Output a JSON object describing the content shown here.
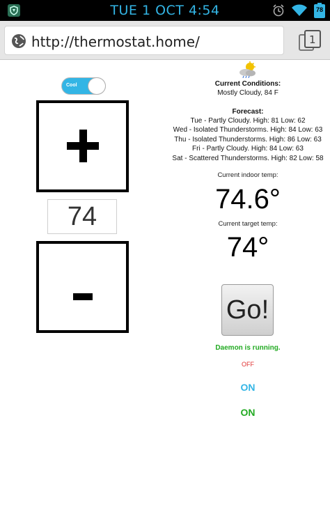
{
  "status_bar": {
    "time": "TUE 1 OCT 4:54",
    "battery_level": "78",
    "icons": [
      "shield-app-icon",
      "alarm-clock-icon",
      "wifi-icon",
      "battery-icon"
    ]
  },
  "browser": {
    "url": "http://thermostat.home/",
    "tabs_count": "1"
  },
  "controls": {
    "mode_toggle_label": "Cool",
    "setpoint_value": "74",
    "go_label": "Go!"
  },
  "weather": {
    "current_title": "Current Conditions:",
    "current_text": "Mostly Cloudy, 84 F",
    "forecast_title": "Forecast:",
    "forecast": [
      "Tue - Partly Cloudy. High: 81 Low: 62",
      "Wed - Isolated Thunderstorms. High: 84 Low: 63",
      "Thu - Isolated Thunderstorms. High: 86 Low: 63",
      "Fri - Partly Cloudy. High: 84 Low: 63",
      "Sat - Scattered Thunderstorms. High: 82 Low: 58"
    ]
  },
  "temps": {
    "indoor_label": "Current indoor temp:",
    "indoor_value": "74.6°",
    "target_label": "Current target temp:",
    "target_value": "74°"
  },
  "status": {
    "daemon": "Daemon is running.",
    "off": "OFF",
    "on_1": "ON",
    "on_2": "ON"
  },
  "colors": {
    "accent_blue": "#33b5e5",
    "status_green": "#22aa22",
    "status_red": "#e03030"
  }
}
